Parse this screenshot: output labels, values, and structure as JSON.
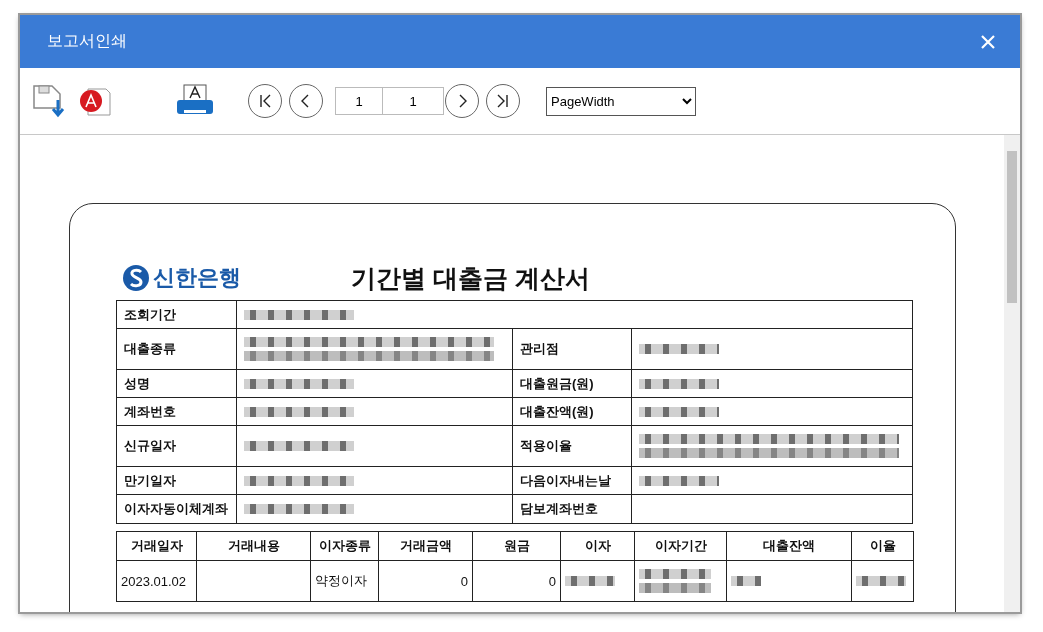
{
  "window": {
    "title": "보고서인쇄"
  },
  "toolbar": {
    "page_current": "1",
    "page_total": "1",
    "zoom": "PageWidth"
  },
  "report": {
    "bank": "신한은행",
    "title": "기간별 대출금 계산서",
    "info_rows": [
      {
        "cells": [
          {
            "label": "조회기간",
            "kind": "redacted"
          }
        ]
      },
      {
        "cells": [
          {
            "label": "대출종류",
            "kind": "redacted2"
          },
          {
            "label": "관리점",
            "kind": "redacted"
          }
        ]
      },
      {
        "cells": [
          {
            "label": "성명",
            "kind": "redacted"
          },
          {
            "label": "대출원금(원)",
            "kind": "redacted"
          }
        ]
      },
      {
        "cells": [
          {
            "label": "계좌번호",
            "kind": "redacted"
          },
          {
            "label": "대출잔액(원)",
            "kind": "redacted"
          }
        ]
      },
      {
        "cells": [
          {
            "label": "신규일자",
            "kind": "redacted"
          },
          {
            "label": "적용이율",
            "kind": "redacted2"
          }
        ]
      },
      {
        "cells": [
          {
            "label": "만기일자",
            "kind": "redacted"
          },
          {
            "label": "다음이자내는날",
            "kind": "redacted"
          }
        ]
      },
      {
        "cells": [
          {
            "label": "이자자동이체계좌",
            "kind": "redacted"
          },
          {
            "label": "담보계좌번호",
            "kind": "empty"
          }
        ]
      }
    ],
    "transactions": {
      "columns": [
        "거래일자",
        "거래내용",
        "이자종류",
        "거래금액",
        "원금",
        "이자",
        "이자기간",
        "대출잔액",
        "이율"
      ],
      "rows": [
        {
          "cells": [
            {
              "kind": "text",
              "text": "2023.01.02"
            },
            {
              "kind": "empty"
            },
            {
              "kind": "text",
              "text": "약정이자"
            },
            {
              "kind": "number",
              "text": "0"
            },
            {
              "kind": "number",
              "text": "0"
            },
            {
              "kind": "redacted"
            },
            {
              "kind": "redacted2"
            },
            {
              "kind": "redacted"
            },
            {
              "kind": "redacted"
            }
          ]
        }
      ]
    }
  }
}
